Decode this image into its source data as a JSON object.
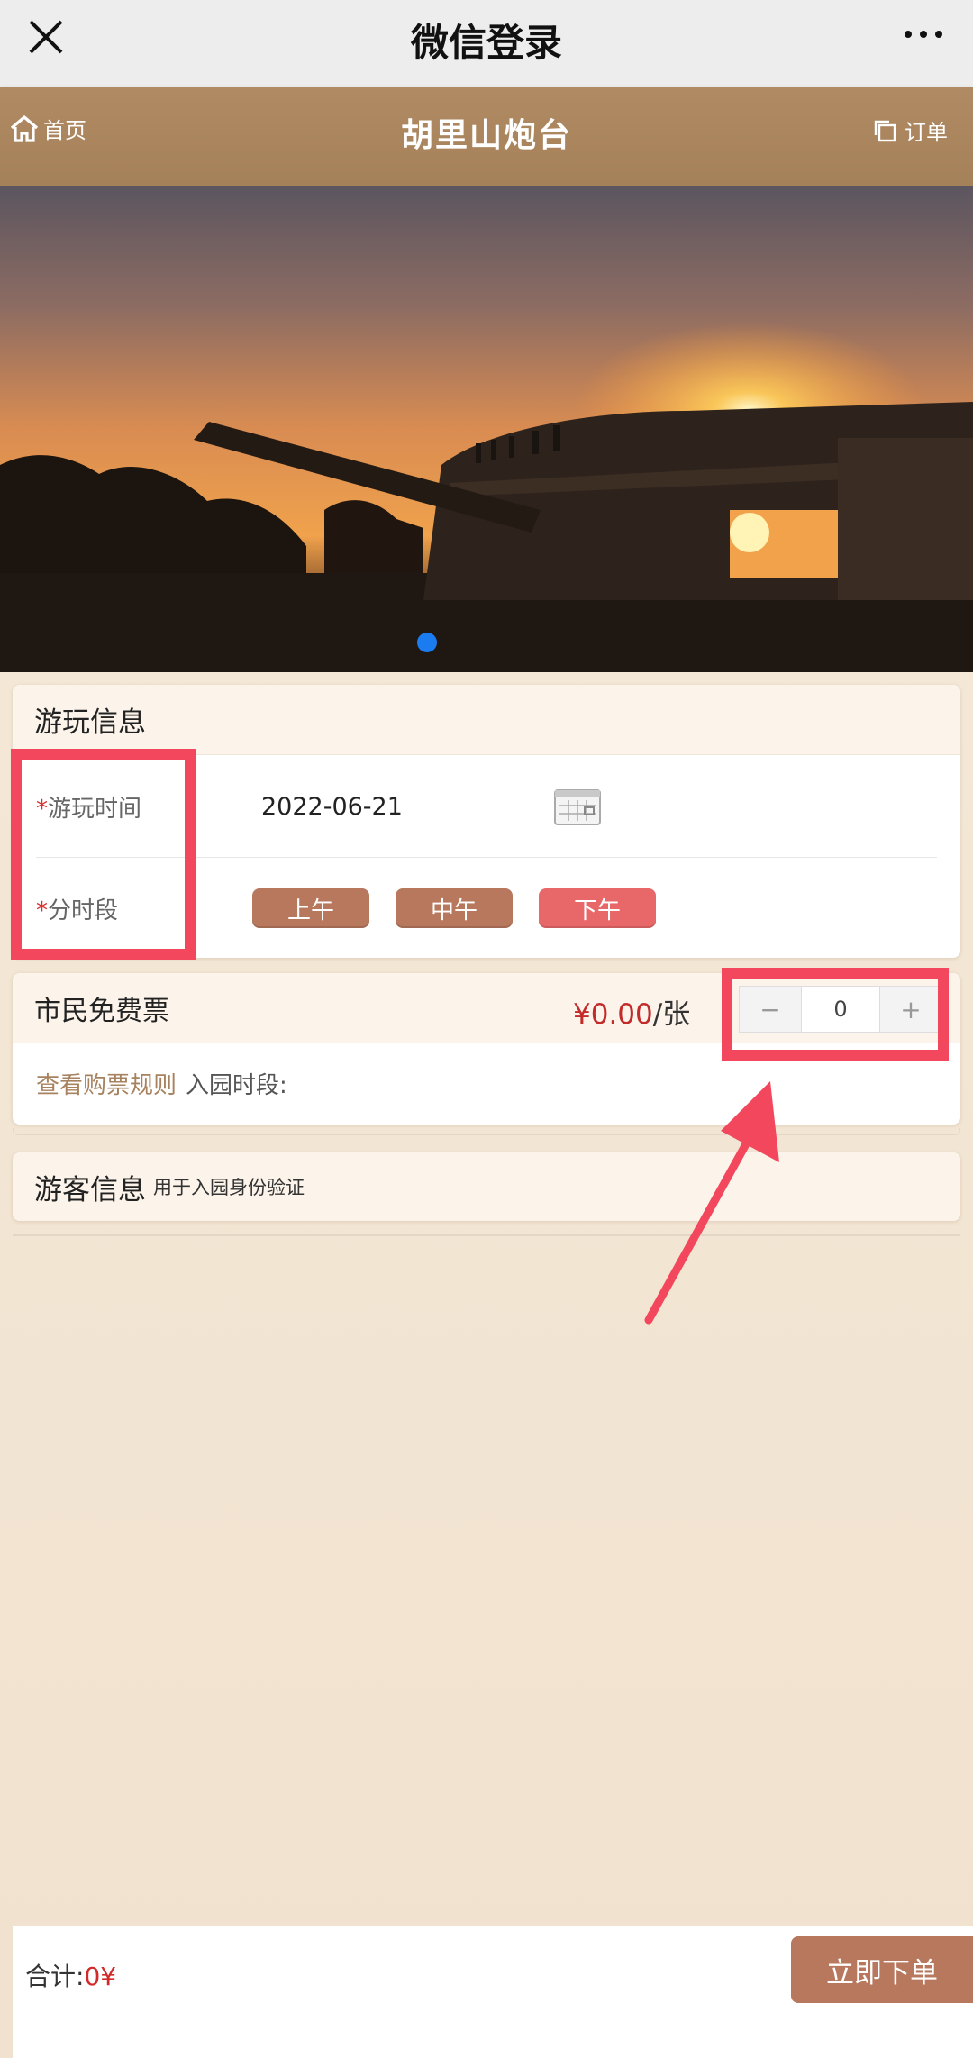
{
  "wechat_bar": {
    "title": "微信登录",
    "close_icon": "close-icon",
    "more_icon": "more-dots-icon"
  },
  "header": {
    "home_label": "首页",
    "home_icon": "home-icon",
    "title": "胡里山炮台",
    "orders_label": "订单",
    "orders_icon": "copy-icon",
    "bg_color": "#a9845d"
  },
  "banner": {
    "image_description_icon": "banner-photo",
    "page_indicator_color": "#1a7cf0"
  },
  "visit_info": {
    "section_title": "游玩信息",
    "date_label": "游玩时间",
    "date_value": "2022-06-21",
    "date_icon": "calendar-icon",
    "slot_label": "分时段",
    "required_mark": "*",
    "slots": [
      {
        "label": "上午",
        "selected": false
      },
      {
        "label": "中午",
        "selected": false
      },
      {
        "label": "下午",
        "selected": true
      }
    ]
  },
  "ticket": {
    "name": "市民免费票",
    "price": "¥0.00",
    "unit": "/张",
    "minus": "−",
    "plus": "+",
    "quantity": "0",
    "rules_link": "查看购票规则",
    "entry_label": "入园时段:"
  },
  "visitor": {
    "section_title": "游客信息",
    "subtitle": "用于入园身份验证"
  },
  "footer": {
    "total_label": "合计:",
    "total_value": "0¥",
    "submit_label": "立即下单",
    "accent_color": "#b8785e",
    "price_color": "#c32a2a"
  },
  "annotations": {
    "highlight_color": "#f2475c"
  }
}
